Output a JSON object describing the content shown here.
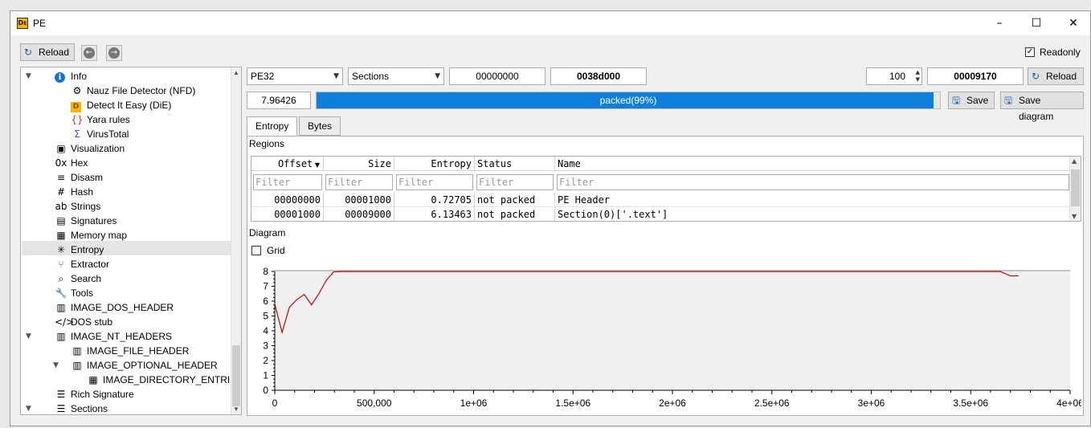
{
  "window": {
    "title": "PE",
    "icon": "die-icon"
  },
  "window_controls": {
    "minimize": "–",
    "maximize": "☐",
    "close": "✕"
  },
  "toolbar": {
    "reload_label": "Reload",
    "readonly_label": "Readonly",
    "readonly_checked": true
  },
  "tree": {
    "items": [
      {
        "label": "Info",
        "icon": "info-icon",
        "level": 0,
        "expanded": true
      },
      {
        "label": "Nauz File Detector (NFD)",
        "icon": "nfd-icon",
        "level": 1
      },
      {
        "label": "Detect It Easy (DiE)",
        "icon": "die-icon",
        "level": 1
      },
      {
        "label": "Yara rules",
        "icon": "yara-icon",
        "level": 1
      },
      {
        "label": "VirusTotal",
        "icon": "virustotal-icon",
        "level": 1
      },
      {
        "label": "Visualization",
        "icon": "image-icon",
        "level": 0
      },
      {
        "label": "Hex",
        "icon": "hex-icon",
        "level": 0
      },
      {
        "label": "Disasm",
        "icon": "disasm-icon",
        "level": 0
      },
      {
        "label": "Hash",
        "icon": "hash-icon",
        "level": 0
      },
      {
        "label": "Strings",
        "icon": "strings-icon",
        "level": 0
      },
      {
        "label": "Signatures",
        "icon": "signatures-icon",
        "level": 0
      },
      {
        "label": "Memory map",
        "icon": "memory-map-icon",
        "level": 0
      },
      {
        "label": "Entropy",
        "icon": "entropy-icon",
        "level": 0,
        "selected": true
      },
      {
        "label": "Extractor",
        "icon": "extractor-icon",
        "level": 0
      },
      {
        "label": "Search",
        "icon": "search-icon",
        "level": 0
      },
      {
        "label": "Tools",
        "icon": "wrench-icon",
        "level": 0
      },
      {
        "label": "IMAGE_DOS_HEADER",
        "icon": "struct-icon",
        "level": 0
      },
      {
        "label": "DOS stub",
        "icon": "code-icon",
        "level": 0
      },
      {
        "label": "IMAGE_NT_HEADERS",
        "icon": "struct-icon",
        "level": 0,
        "expanded": true
      },
      {
        "label": "IMAGE_FILE_HEADER",
        "icon": "struct-icon",
        "level": 1
      },
      {
        "label": "IMAGE_OPTIONAL_HEADER",
        "icon": "struct-icon",
        "level": 1,
        "expanded": true
      },
      {
        "label": "IMAGE_DIRECTORY_ENTRIES",
        "icon": "table-icon",
        "level": 2
      },
      {
        "label": "Rich Signature",
        "icon": "list-icon",
        "level": 0
      },
      {
        "label": "Sections",
        "icon": "list-icon",
        "level": 0,
        "expanded": true
      }
    ]
  },
  "controls": {
    "type_select": "PE32",
    "mode_select": "Sections",
    "offset": "00000000",
    "size": "0038d000",
    "count": "100",
    "count_result": "00009170",
    "reload_label": "Reload",
    "entropy_value": "7.96426",
    "status_text": "packed(99%)",
    "status_progress": 0.99,
    "save_label": "Save",
    "save_diagram_label": "Save diagram"
  },
  "tabs": [
    {
      "label": "Entropy",
      "active": true
    },
    {
      "label": "Bytes",
      "active": false
    }
  ],
  "regions": {
    "label": "Regions",
    "columns": [
      "Offset",
      "Size",
      "Entropy",
      "Status",
      "Name"
    ],
    "filter_placeholder": "Filter",
    "rows": [
      [
        "00000000",
        "00001000",
        "0.72705",
        "not packed",
        "PE Header"
      ],
      [
        "00001000",
        "00009000",
        "6.13463",
        "not packed",
        "Section(0)['.text']"
      ]
    ]
  },
  "diagram": {
    "label": "Diagram",
    "grid_label": "Grid",
    "grid_checked": false
  },
  "chart_data": {
    "type": "line",
    "title": "",
    "xlabel": "",
    "ylabel": "",
    "xlim": [
      0,
      4000000
    ],
    "ylim": [
      0,
      8
    ],
    "xticks": [
      0,
      500000,
      1000000,
      1500000,
      2000000,
      2500000,
      3000000,
      3500000,
      4000000
    ],
    "xtick_labels": [
      "0",
      "500,000",
      "1e+06",
      "1.5e+06",
      "2e+06",
      "2.5e+06",
      "3e+06",
      "3.5e+06",
      "4e+06"
    ],
    "yticks": [
      0,
      1,
      2,
      3,
      4,
      5,
      6,
      7,
      8
    ],
    "grid": false,
    "line_color": "#cc0000",
    "series": [
      {
        "x": [
          0,
          37000,
          74000,
          111000,
          148000,
          185000,
          222000,
          259000,
          296000,
          333000,
          500000,
          1000000,
          2000000,
          3000000,
          3650000,
          3700000,
          3740000
        ],
        "y": [
          5.8,
          3.9,
          5.6,
          6.1,
          6.45,
          5.75,
          6.5,
          7.4,
          7.97,
          7.99,
          7.99,
          7.99,
          7.99,
          7.99,
          7.99,
          7.7,
          7.7
        ]
      }
    ]
  },
  "colors": {
    "accent": "#0f7fdc",
    "chart_line": "#cc0000"
  }
}
